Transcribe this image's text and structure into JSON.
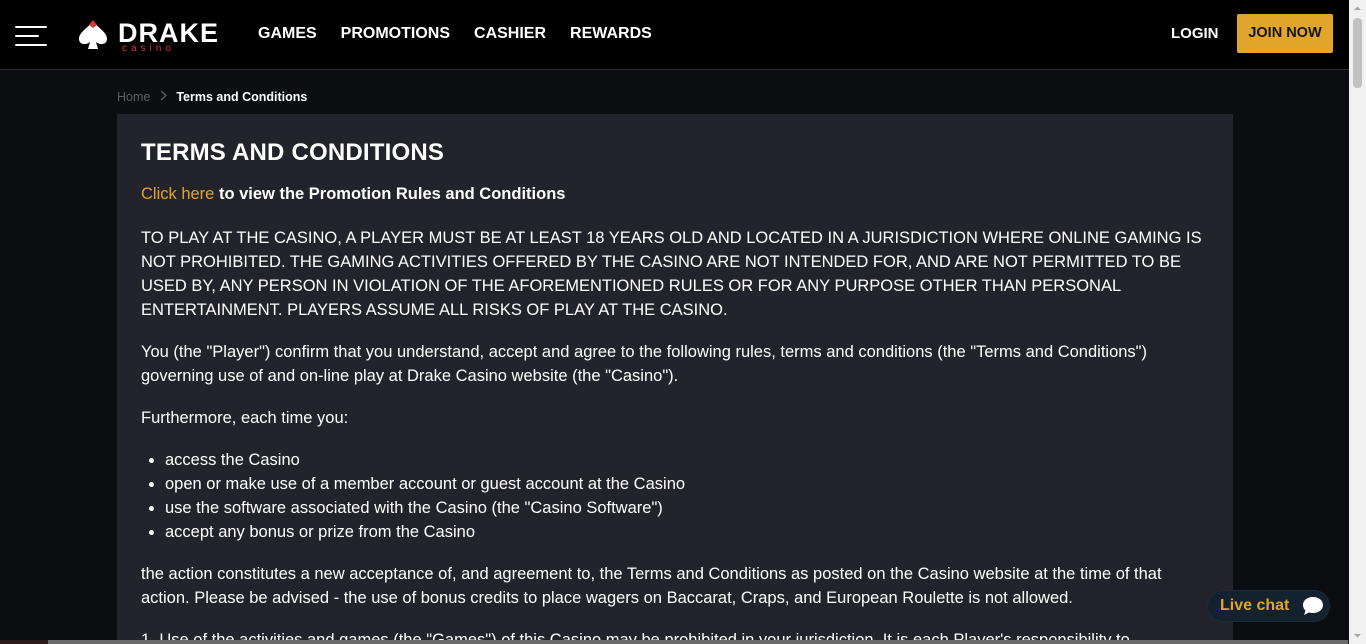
{
  "header": {
    "menu_icon": "hamburger-icon",
    "logo": {
      "name": "DRAKE",
      "sub": "casino",
      "icon": "drake-spade-logo-icon"
    },
    "nav": [
      {
        "label": "GAMES"
      },
      {
        "label": "PROMOTIONS"
      },
      {
        "label": "CASHIER"
      },
      {
        "label": "REWARDS"
      }
    ],
    "login_label": "LOGIN",
    "join_label": "JOIN NOW"
  },
  "breadcrumb": {
    "home": "Home",
    "current": "Terms and Conditions"
  },
  "content": {
    "title": "TERMS AND CONDITIONS",
    "promo_link": "Click here",
    "promo_text": "to view the Promotion Rules and Conditions",
    "paragraphs": [
      "TO PLAY AT THE CASINO, A PLAYER MUST BE AT LEAST 18 YEARS OLD AND LOCATED IN A JURISDICTION WHERE ONLINE GAMING IS NOT PROHIBITED. THE GAMING ACTIVITIES OFFERED BY THE CASINO ARE NOT INTENDED FOR, AND ARE NOT PERMITTED TO BE USED BY, ANY PERSON IN VIOLATION OF THE AFOREMENTIONED RULES OR FOR ANY PURPOSE OTHER THAN PERSONAL ENTERTAINMENT. PLAYERS ASSUME ALL RISKS OF PLAY AT THE CASINO.",
      "You (the \"Player\") confirm that you understand, accept and agree to the following rules, terms and conditions (the \"Terms and Conditions\") governing use of and on-line play at Drake Casino website (the \"Casino\").",
      "Furthermore, each time you:"
    ],
    "list": [
      "access the Casino",
      "open or make use of a member account or guest account at the Casino",
      "use the software associated with the Casino (the \"Casino Software\")",
      "accept any bonus or prize from the Casino"
    ],
    "after_list": "the action constitutes a new acceptance of, and agreement to, the Terms and Conditions as posted on the Casino website at the time of that action. Please be advised - the use of bonus credits to place wagers on Baccarat, Craps, and European Roulette is not allowed.",
    "numbered_first": "1. Use of the activities and games (the \"Games\") of this Casino may be prohibited in your jurisdiction. It is each Player's responsibility to"
  },
  "livechat": {
    "label": "Live chat",
    "icon": "chat-bubble-icon"
  },
  "colors": {
    "accent": "#e0a52a",
    "panel": "#23242b",
    "background": "#0c0d11",
    "logo_red": "#d23a3a"
  }
}
